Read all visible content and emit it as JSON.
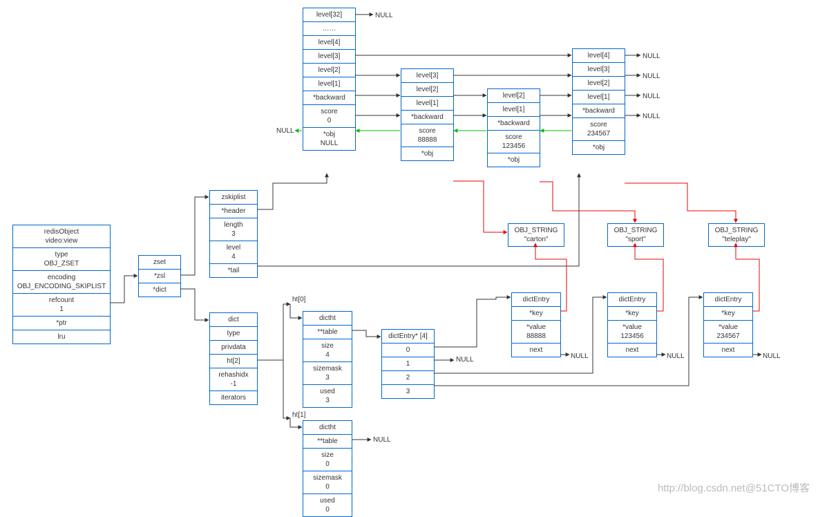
{
  "redisObject": {
    "title": "redisObject\nvideo:view",
    "rows": [
      "type\nOBJ_ZSET",
      "encoding\nOBJ_ENCODING_SKIPLIST",
      "refcount\n1",
      "*ptr",
      "lru"
    ]
  },
  "zset": {
    "title": "zset",
    "rows": [
      "*zsl",
      "*dict"
    ]
  },
  "zskiplist": {
    "title": "zskiplist",
    "rows": [
      "*header",
      "length\n3",
      "level\n4",
      "*tail"
    ]
  },
  "dict": {
    "title": "dict",
    "rows": [
      "type",
      "privdata",
      "ht[2]",
      "rehashidx\n-1",
      "iterators"
    ]
  },
  "htLabels": {
    "ht0": "ht[0]",
    "ht1": "ht[1]"
  },
  "dictht0": {
    "title": "dictht",
    "rows": [
      "**table",
      "size\n4",
      "sizemask\n3",
      "used\n3"
    ]
  },
  "dictht1": {
    "title": "dictht",
    "rows": [
      "**table",
      "size\n0",
      "sizemask\n0",
      "used\n0"
    ]
  },
  "dictEntryArr": {
    "title": "dictEntry* [4]",
    "rows": [
      "0",
      "1",
      "2",
      "3"
    ]
  },
  "null": "NULL",
  "skipHeader": {
    "rows": [
      "level[32]",
      "……",
      "level[4]",
      "level[3]",
      "level[2]",
      "level[1]",
      "*backward",
      "score\n0",
      "*obj\nNULL"
    ]
  },
  "node1": {
    "rows": [
      "level[3]",
      "level[2]",
      "level[1]",
      "*backward",
      "score\n88888",
      "*obj"
    ]
  },
  "node2": {
    "rows": [
      "level[2]",
      "level[1]",
      "*backward",
      "score\n123456",
      "*obj"
    ]
  },
  "node3": {
    "rows": [
      "level[4]",
      "level[3]",
      "level[2]",
      "level[1]",
      "*backward",
      "score\n234567",
      "*obj"
    ]
  },
  "objStr": {
    "carton": "OBJ_STRING\n\"carton\"",
    "sport": "OBJ_STRING\n\"sport\"",
    "teleplay": "OBJ_STRING\n\"teleplay\""
  },
  "dictEntry": {
    "title": "dictEntry",
    "key": "*key",
    "next": "next",
    "val1": "*value\n88888",
    "val2": "*value\n123456",
    "val3": "*value\n234567"
  },
  "watermark": "http://blog.csdn.net@51CTO博客",
  "chart_data": {
    "type": "diagram",
    "description": "Redis zset internal memory layout: redisObject -> zset -> (zskiplist + dict). zskiplist header has 32 levels; 3 data nodes with scores 88888/123456/234567 whose *obj pointers reference OBJ_STRING carton/sport/teleplay. dict has ht[0] (size 4, used 3) whose table[0],table[2],table[3] point to dictEntry nodes (values 88888/123456/234567) whose *key pointers share the same OBJ_STRING objects; table[1] and ht[1].table are NULL; backward pointers chain nodes right-to-left, header backward = NULL.",
    "nodes": [
      {
        "id": "redisObject",
        "fields": [
          "type=OBJ_ZSET",
          "encoding=OBJ_ENCODING_SKIPLIST",
          "refcount=1",
          "*ptr",
          "lru"
        ]
      },
      {
        "id": "zset",
        "fields": [
          "*zsl",
          "*dict"
        ]
      },
      {
        "id": "zskiplist",
        "fields": [
          "*header",
          "length=3",
          "level=4",
          "*tail"
        ]
      },
      {
        "id": "dict",
        "fields": [
          "type",
          "privdata",
          "ht[2]",
          "rehashidx=-1",
          "iterators"
        ]
      },
      {
        "id": "dictht0",
        "fields": [
          "**table",
          "size=4",
          "sizemask=3",
          "used=3"
        ]
      },
      {
        "id": "dictht1",
        "fields": [
          "**table",
          "size=0",
          "sizemask=0",
          "used=0"
        ]
      },
      {
        "id": "dictEntryArray",
        "slots": [
          0,
          1,
          2,
          3
        ]
      },
      {
        "id": "skipHeader",
        "levels": 32,
        "score": 0,
        "obj": null
      },
      {
        "id": "skipNode1",
        "levels": 3,
        "score": 88888,
        "obj": "carton"
      },
      {
        "id": "skipNode2",
        "levels": 2,
        "score": 123456,
        "obj": "sport"
      },
      {
        "id": "skipNode3",
        "levels": 4,
        "score": 234567,
        "obj": "teleplay"
      },
      {
        "id": "dictEntry1",
        "value": 88888,
        "key": "carton"
      },
      {
        "id": "dictEntry2",
        "value": 123456,
        "key": "sport"
      },
      {
        "id": "dictEntry3",
        "value": 234567,
        "key": "teleplay"
      }
    ],
    "edges": [
      {
        "from": "redisObject.*ptr",
        "to": "zset",
        "color": "black"
      },
      {
        "from": "zset.*zsl",
        "to": "zskiplist",
        "color": "black"
      },
      {
        "from": "zset.*dict",
        "to": "dict",
        "color": "black"
      },
      {
        "from": "zskiplist.*header",
        "to": "skipHeader",
        "color": "black"
      },
      {
        "from": "zskiplist.*tail",
        "to": "skipNode3",
        "color": "black"
      },
      {
        "from": "dict.ht[2]",
        "to": "dictht0",
        "label": "ht[0]",
        "color": "black"
      },
      {
        "from": "dict.ht[2]",
        "to": "dictht1",
        "label": "ht[1]",
        "color": "black"
      },
      {
        "from": "dictht0.**table",
        "to": "dictEntryArray",
        "color": "black"
      },
      {
        "from": "dictht1.**table",
        "to": "NULL",
        "color": "black"
      },
      {
        "from": "dictEntryArray[0]",
        "to": "dictEntry1",
        "color": "black"
      },
      {
        "from": "dictEntryArray[1]",
        "to": "NULL",
        "color": "black"
      },
      {
        "from": "dictEntryArray[2]",
        "to": "dictEntry2",
        "color": "black"
      },
      {
        "from": "dictEntryArray[3]",
        "to": "dictEntry3",
        "color": "black"
      },
      {
        "from": "dictEntry1.next",
        "to": "NULL",
        "color": "black"
      },
      {
        "from": "dictEntry2.next",
        "to": "NULL",
        "color": "black"
      },
      {
        "from": "dictEntry3.next",
        "to": "NULL",
        "color": "black"
      },
      {
        "from": "dictEntry1.*key",
        "to": "OBJ_STRING carton",
        "color": "red"
      },
      {
        "from": "dictEntry2.*key",
        "to": "OBJ_STRING sport",
        "color": "red"
      },
      {
        "from": "dictEntry3.*key",
        "to": "OBJ_STRING teleplay",
        "color": "red"
      },
      {
        "from": "skipNode1.*obj",
        "to": "OBJ_STRING carton",
        "color": "red"
      },
      {
        "from": "skipNode2.*obj",
        "to": "OBJ_STRING sport",
        "color": "red"
      },
      {
        "from": "skipNode3.*obj",
        "to": "OBJ_STRING teleplay",
        "color": "red"
      },
      {
        "from": "skipHeader.level[4]",
        "to": "skipNode3.level[4]",
        "color": "black"
      },
      {
        "from": "skipHeader.level[3]",
        "to": "skipNode1.level[3]",
        "color": "black"
      },
      {
        "from": "skipHeader.level[2]",
        "to": "skipNode1.level[2]",
        "color": "black"
      },
      {
        "from": "skipHeader.level[1]",
        "to": "skipNode1.level[1]",
        "color": "black"
      },
      {
        "from": "skipHeader.level[32]",
        "to": "NULL",
        "color": "black"
      },
      {
        "from": "skipNode1.level[3]",
        "to": "skipNode3.level[3]",
        "color": "black"
      },
      {
        "from": "skipNode1.level[2]",
        "to": "skipNode2.level[2]",
        "color": "black"
      },
      {
        "from": "skipNode1.level[1]",
        "to": "skipNode2.level[1]",
        "color": "black"
      },
      {
        "from": "skipNode2.level[2]",
        "to": "skipNode3.level[2]",
        "color": "black"
      },
      {
        "from": "skipNode2.level[1]",
        "to": "skipNode3.level[1]",
        "color": "black"
      },
      {
        "from": "skipNode3.level[4]",
        "to": "NULL",
        "color": "black"
      },
      {
        "from": "skipNode3.level[3]",
        "to": "NULL",
        "color": "black"
      },
      {
        "from": "skipNode3.level[2]",
        "to": "NULL",
        "color": "black"
      },
      {
        "from": "skipNode3.level[1]",
        "to": "NULL",
        "color": "black"
      },
      {
        "from": "skipHeader.*backward",
        "to": "NULL",
        "color": "green"
      },
      {
        "from": "skipNode1.*backward",
        "to": "skipHeader",
        "color": "green"
      },
      {
        "from": "skipNode2.*backward",
        "to": "skipNode1",
        "color": "green"
      },
      {
        "from": "skipNode3.*backward",
        "to": "skipNode2",
        "color": "green"
      }
    ]
  }
}
